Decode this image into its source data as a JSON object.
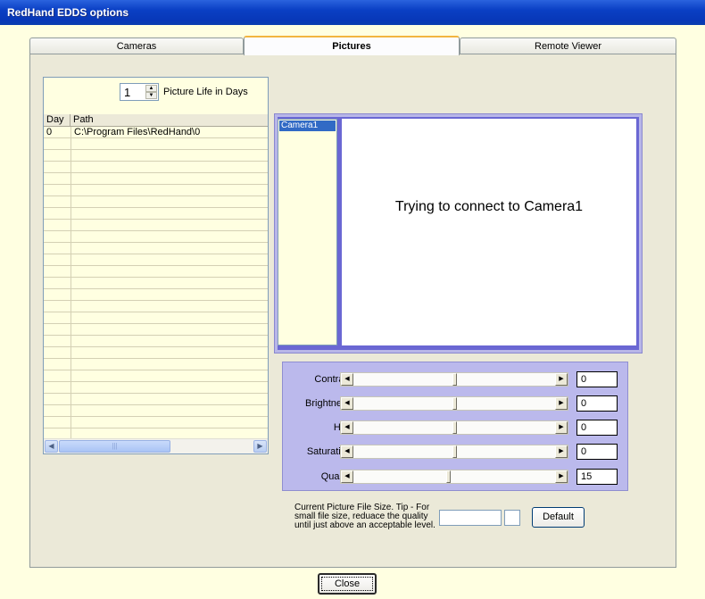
{
  "window": {
    "title": "RedHand EDDS options"
  },
  "tabs": [
    {
      "label": "Cameras",
      "active": false
    },
    {
      "label": "Pictures",
      "active": true
    },
    {
      "label": "Remote Viewer",
      "active": false
    }
  ],
  "picture_life": {
    "value": "1",
    "label": "Picture Life in Days"
  },
  "grid": {
    "columns": [
      "Day",
      "Path"
    ],
    "rows": [
      {
        "day": "0",
        "path": "C:\\Program Files\\RedHand\\0"
      }
    ]
  },
  "camera_list": {
    "items": [
      "Camera1"
    ],
    "selected": "Camera1"
  },
  "preview": {
    "status_text": "Trying to connect to Camera1"
  },
  "adjustments": [
    {
      "label": "Contrast",
      "value": "0",
      "level": 0.5
    },
    {
      "label": "Brightness",
      "value": "0",
      "level": 0.5
    },
    {
      "label": "Hue",
      "value": "0",
      "level": 0.5
    },
    {
      "label": "Saturation",
      "value": "0",
      "level": 0.5
    },
    {
      "label": "Quality",
      "value": "15",
      "level": 0.47
    }
  ],
  "file_size": {
    "tip": "Current Picture File Size. Tip - For small file size, reduace the quality until  just above an acceptable level.",
    "size_value": "",
    "unit_value": ""
  },
  "buttons": {
    "default": "Default",
    "close": "Close"
  },
  "icons": {
    "spin_up": "▲",
    "spin_down": "▼",
    "scroll_left": "◀",
    "scroll_right": "▶",
    "scroll_grip": "|||"
  }
}
